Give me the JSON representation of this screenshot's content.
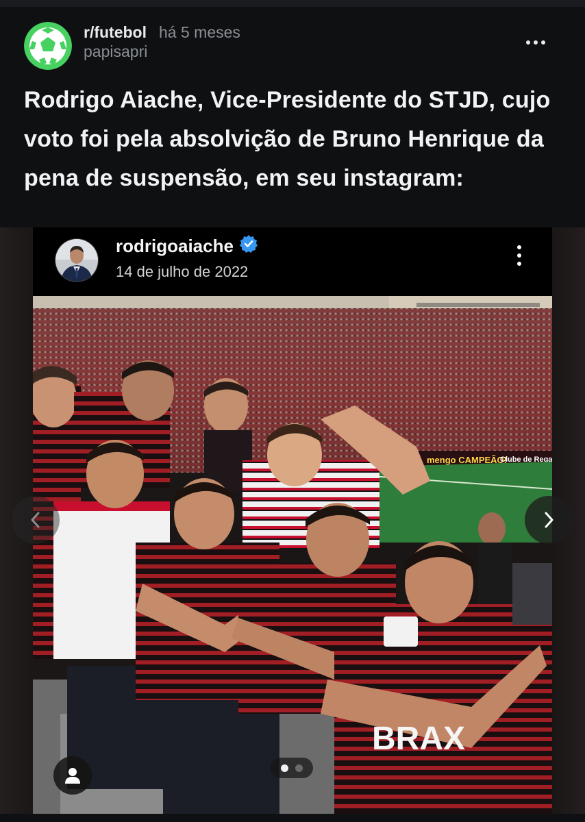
{
  "post": {
    "subreddit": "r/futebol",
    "time_ago": "há 5 meses",
    "author": "papisapri",
    "title": "Rodrigo Aiache, Vice-Presidente do STJD, cujo voto foi pela absolvição de Bruno Henrique da pena de suspensão, em seu instagram:",
    "avatar_icon": "soccer-ball-icon",
    "more_icon": "more-horizontal-icon"
  },
  "instagram": {
    "username": "rodrigoaiache",
    "date": "14 de julho de 2022",
    "verified_icon": "verified-badge-icon",
    "more_icon": "more-vertical-icon"
  },
  "photo": {
    "banner_text": "mengo CAMPEÃO!",
    "banner_text_2": "Clube de Regatas",
    "jersey_text": "BRAX"
  },
  "carousel": {
    "pages": 2,
    "current": 1,
    "prev_icon": "chevron-left-icon",
    "next_icon": "chevron-right-icon",
    "user_tag_icon": "person-icon"
  },
  "colors": {
    "background": "#0b0c0f",
    "text": "#e8ebee",
    "muted": "#8a8f95",
    "accent_green": "#46d160",
    "verified_blue": "#3897f0",
    "flamengo_red": "#c8102e"
  }
}
